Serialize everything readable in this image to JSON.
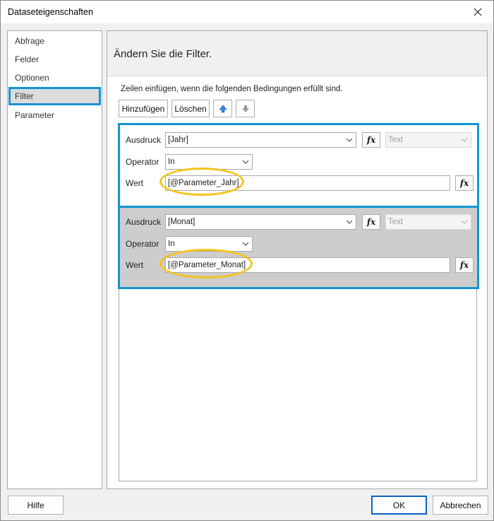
{
  "window": {
    "title": "Dataseteigenschaften"
  },
  "nav": {
    "items": [
      {
        "label": "Abfrage"
      },
      {
        "label": "Felder"
      },
      {
        "label": "Optionen"
      },
      {
        "label": "Filter"
      },
      {
        "label": "Parameter"
      }
    ],
    "selected": "Filter"
  },
  "content": {
    "heading": "Ändern Sie die Filter.",
    "instruction": "Zeilen einfügen, wenn die folgenden Bedingungen erfüllt sind.",
    "toolbar": {
      "add_label": "Hinzufügen",
      "delete_label": "Löschen",
      "move_up_icon": "arrow-up-icon",
      "move_down_icon": "arrow-down-icon"
    },
    "filters": [
      {
        "expression_label": "Ausdruck",
        "expression": "[Jahr]",
        "type": "Text",
        "operator_label": "Operator",
        "operator": "In",
        "value_label": "Wert",
        "value": "[@Parameter_Jahr]"
      },
      {
        "expression_label": "Ausdruck",
        "expression": "[Monat]",
        "type": "Text",
        "operator_label": "Operator",
        "operator": "In",
        "value_label": "Wert",
        "value": "[@Parameter_Monat]"
      }
    ]
  },
  "footer": {
    "help_label": "Hilfe",
    "ok_label": "OK",
    "cancel_label": "Abbrechen"
  },
  "colors": {
    "highlight_border": "#1495d1",
    "annotation_ellipse": "#f5c31c",
    "up_arrow": "#2e86de"
  }
}
